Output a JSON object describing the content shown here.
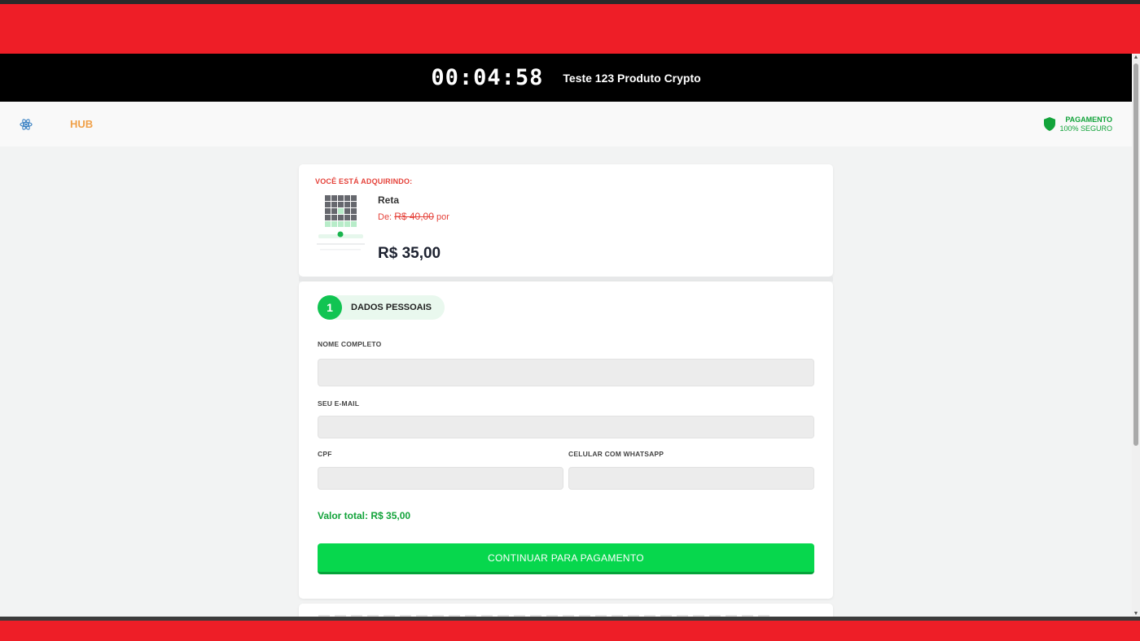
{
  "timer": {
    "countdown": "00:04:58",
    "product_title": "Teste 123 Produto Crypto"
  },
  "header": {
    "logo_text": "HUB",
    "secure_line1": "PAGAMENTO",
    "secure_line2": "100% SEGURO"
  },
  "product": {
    "heading": "VOCÊ ESTÁ ADQUIRINDO:",
    "name": "Reta",
    "old_price_prefix": "De:",
    "old_price": "R$ 40,00",
    "old_price_suffix": "por",
    "price": "R$ 35,00"
  },
  "form": {
    "step_number": "1",
    "step_title": "DADOS PESSOAIS",
    "name_label": "NOME COMPLETO",
    "name_value": "",
    "email_label": "SEU E-MAIL",
    "email_value": "",
    "cpf_label": "CPF",
    "cpf_value": "",
    "phone_label": "CELULAR COM WHATSAPP",
    "phone_value": "",
    "total_label": "Valor total: R$ 35,00",
    "submit_label": "CONTINUAR PARA PAGAMENTO"
  },
  "colors": {
    "brand_red": "#ee1e27",
    "accent_green": "#07d74d",
    "text_green": "#12a33a",
    "price_red": "#e5423a",
    "logo_orange": "#f0a048"
  },
  "icons": [
    "atom-logo-icon",
    "shield-icon",
    "product-thumbnail"
  ]
}
